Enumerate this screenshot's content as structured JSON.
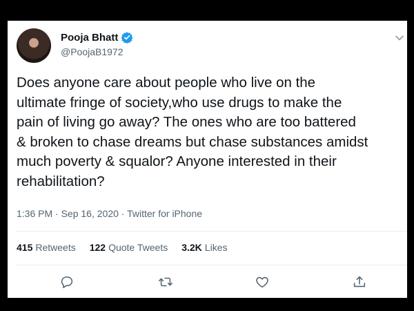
{
  "tweet": {
    "author": {
      "name": "Pooja Bhatt",
      "handle": "@PoojaB1972",
      "verified": true
    },
    "text_lines": [
      "Does anyone care about people who live on the",
      "ultimate fringe of society,who use drugs to make the",
      "pain of living go away? The ones who are too battered",
      "& broken to chase dreams but chase substances amidst",
      "much poverty & squalor? Anyone interested in their",
      "rehabilitation?"
    ],
    "meta": {
      "time": "1:36 PM",
      "separator": " · ",
      "date": "Sep 16, 2020",
      "source": "Twitter for iPhone"
    },
    "stats": {
      "retweets_count": "415",
      "retweets_label": "Retweets",
      "quote_tweets_count": "122",
      "quote_tweets_label": "Quote Tweets",
      "likes_count": "3.2K",
      "likes_label": "Likes"
    },
    "actions": [
      "reply-icon",
      "retweet-icon",
      "like-icon",
      "share-icon"
    ]
  },
  "colors": {
    "background": "#000000",
    "card": "#ffffff",
    "text": "#0f1419",
    "secondary_text": "#536471",
    "verified": "#1d9bf0",
    "divider": "#e6ecf0"
  }
}
